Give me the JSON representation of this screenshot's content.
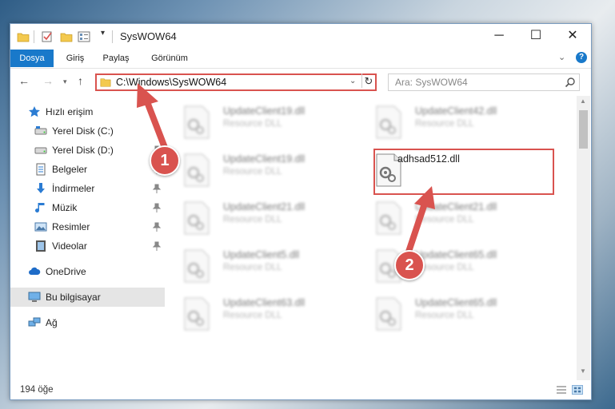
{
  "window": {
    "title": "SysWOW64",
    "min_label": "─",
    "max_label": "☐",
    "close_label": "✕"
  },
  "ribbon": {
    "tabs": [
      "Dosya",
      "Giriş",
      "Paylaş",
      "Görünüm"
    ],
    "help_label": "?"
  },
  "nav": {
    "back": "←",
    "forward": "→",
    "recent": "▾",
    "up": "↑"
  },
  "address": {
    "path": "C:\\Windows\\SysWOW64",
    "drop": "⌄",
    "refresh": "↻"
  },
  "search": {
    "placeholder": "Ara: SysWOW64"
  },
  "sidebar": {
    "items": [
      {
        "label": "Hızlı erişim",
        "icon": "star-icon"
      },
      {
        "label": "Yerel Disk (C:)",
        "icon": "drive-icon"
      },
      {
        "label": "Yerel Disk (D:)",
        "icon": "drive-icon"
      },
      {
        "label": "Belgeler",
        "icon": "documents-icon"
      },
      {
        "label": "İndirmeler",
        "icon": "download-icon"
      },
      {
        "label": "Müzik",
        "icon": "music-icon"
      },
      {
        "label": "Resimler",
        "icon": "pictures-icon"
      },
      {
        "label": "Videolar",
        "icon": "videos-icon"
      },
      {
        "label": "OneDrive",
        "icon": "cloud-icon"
      },
      {
        "label": "Bu bilgisayar",
        "icon": "computer-icon"
      },
      {
        "label": "Ağ",
        "icon": "network-icon"
      }
    ]
  },
  "files": [
    {
      "name": "UpdateClient19.dll",
      "type": "Resource DLL"
    },
    {
      "name": "UpdateClient42.dll",
      "type": "Resource DLL"
    },
    {
      "name": "UpdateClient19.dll",
      "type": "Resource DLL"
    },
    {
      "name": "adhsad512.dll",
      "type": ""
    },
    {
      "name": "UpdateClient21.dll",
      "type": "Resource DLL"
    },
    {
      "name": "UpdateClient21.dll",
      "type": "Resource DLL"
    },
    {
      "name": "UpdateClient5.dll",
      "type": "Resource DLL"
    },
    {
      "name": "UpdateClient65.dll",
      "type": "Resource DLL"
    },
    {
      "name": "UpdateClient63.dll",
      "type": "Resource DLL"
    },
    {
      "name": "UpdateClient65.dll",
      "type": "Resource DLL"
    }
  ],
  "status": {
    "count": "194 öğe"
  },
  "annotations": {
    "step1": "1",
    "step2": "2",
    "color": "#d9534f"
  }
}
